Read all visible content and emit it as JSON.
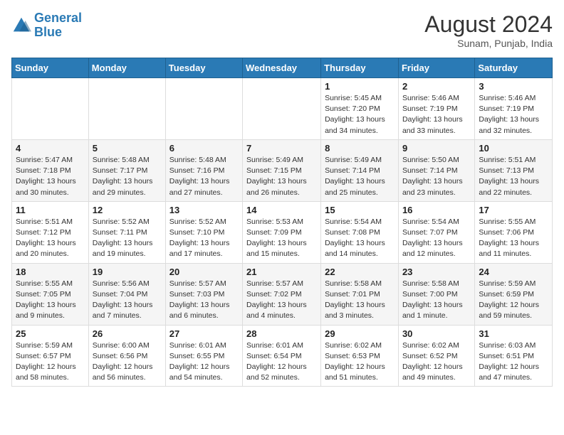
{
  "header": {
    "logo_general": "General",
    "logo_blue": "Blue",
    "month_year": "August 2024",
    "location": "Sunam, Punjab, India"
  },
  "days_of_week": [
    "Sunday",
    "Monday",
    "Tuesday",
    "Wednesday",
    "Thursday",
    "Friday",
    "Saturday"
  ],
  "weeks": [
    [
      {
        "day": "",
        "info": ""
      },
      {
        "day": "",
        "info": ""
      },
      {
        "day": "",
        "info": ""
      },
      {
        "day": "",
        "info": ""
      },
      {
        "day": "1",
        "info": "Sunrise: 5:45 AM\nSunset: 7:20 PM\nDaylight: 13 hours\nand 34 minutes."
      },
      {
        "day": "2",
        "info": "Sunrise: 5:46 AM\nSunset: 7:19 PM\nDaylight: 13 hours\nand 33 minutes."
      },
      {
        "day": "3",
        "info": "Sunrise: 5:46 AM\nSunset: 7:19 PM\nDaylight: 13 hours\nand 32 minutes."
      }
    ],
    [
      {
        "day": "4",
        "info": "Sunrise: 5:47 AM\nSunset: 7:18 PM\nDaylight: 13 hours\nand 30 minutes."
      },
      {
        "day": "5",
        "info": "Sunrise: 5:48 AM\nSunset: 7:17 PM\nDaylight: 13 hours\nand 29 minutes."
      },
      {
        "day": "6",
        "info": "Sunrise: 5:48 AM\nSunset: 7:16 PM\nDaylight: 13 hours\nand 27 minutes."
      },
      {
        "day": "7",
        "info": "Sunrise: 5:49 AM\nSunset: 7:15 PM\nDaylight: 13 hours\nand 26 minutes."
      },
      {
        "day": "8",
        "info": "Sunrise: 5:49 AM\nSunset: 7:14 PM\nDaylight: 13 hours\nand 25 minutes."
      },
      {
        "day": "9",
        "info": "Sunrise: 5:50 AM\nSunset: 7:14 PM\nDaylight: 13 hours\nand 23 minutes."
      },
      {
        "day": "10",
        "info": "Sunrise: 5:51 AM\nSunset: 7:13 PM\nDaylight: 13 hours\nand 22 minutes."
      }
    ],
    [
      {
        "day": "11",
        "info": "Sunrise: 5:51 AM\nSunset: 7:12 PM\nDaylight: 13 hours\nand 20 minutes."
      },
      {
        "day": "12",
        "info": "Sunrise: 5:52 AM\nSunset: 7:11 PM\nDaylight: 13 hours\nand 19 minutes."
      },
      {
        "day": "13",
        "info": "Sunrise: 5:52 AM\nSunset: 7:10 PM\nDaylight: 13 hours\nand 17 minutes."
      },
      {
        "day": "14",
        "info": "Sunrise: 5:53 AM\nSunset: 7:09 PM\nDaylight: 13 hours\nand 15 minutes."
      },
      {
        "day": "15",
        "info": "Sunrise: 5:54 AM\nSunset: 7:08 PM\nDaylight: 13 hours\nand 14 minutes."
      },
      {
        "day": "16",
        "info": "Sunrise: 5:54 AM\nSunset: 7:07 PM\nDaylight: 13 hours\nand 12 minutes."
      },
      {
        "day": "17",
        "info": "Sunrise: 5:55 AM\nSunset: 7:06 PM\nDaylight: 13 hours\nand 11 minutes."
      }
    ],
    [
      {
        "day": "18",
        "info": "Sunrise: 5:55 AM\nSunset: 7:05 PM\nDaylight: 13 hours\nand 9 minutes."
      },
      {
        "day": "19",
        "info": "Sunrise: 5:56 AM\nSunset: 7:04 PM\nDaylight: 13 hours\nand 7 minutes."
      },
      {
        "day": "20",
        "info": "Sunrise: 5:57 AM\nSunset: 7:03 PM\nDaylight: 13 hours\nand 6 minutes."
      },
      {
        "day": "21",
        "info": "Sunrise: 5:57 AM\nSunset: 7:02 PM\nDaylight: 13 hours\nand 4 minutes."
      },
      {
        "day": "22",
        "info": "Sunrise: 5:58 AM\nSunset: 7:01 PM\nDaylight: 13 hours\nand 3 minutes."
      },
      {
        "day": "23",
        "info": "Sunrise: 5:58 AM\nSunset: 7:00 PM\nDaylight: 13 hours\nand 1 minute."
      },
      {
        "day": "24",
        "info": "Sunrise: 5:59 AM\nSunset: 6:59 PM\nDaylight: 12 hours\nand 59 minutes."
      }
    ],
    [
      {
        "day": "25",
        "info": "Sunrise: 5:59 AM\nSunset: 6:57 PM\nDaylight: 12 hours\nand 58 minutes."
      },
      {
        "day": "26",
        "info": "Sunrise: 6:00 AM\nSunset: 6:56 PM\nDaylight: 12 hours\nand 56 minutes."
      },
      {
        "day": "27",
        "info": "Sunrise: 6:01 AM\nSunset: 6:55 PM\nDaylight: 12 hours\nand 54 minutes."
      },
      {
        "day": "28",
        "info": "Sunrise: 6:01 AM\nSunset: 6:54 PM\nDaylight: 12 hours\nand 52 minutes."
      },
      {
        "day": "29",
        "info": "Sunrise: 6:02 AM\nSunset: 6:53 PM\nDaylight: 12 hours\nand 51 minutes."
      },
      {
        "day": "30",
        "info": "Sunrise: 6:02 AM\nSunset: 6:52 PM\nDaylight: 12 hours\nand 49 minutes."
      },
      {
        "day": "31",
        "info": "Sunrise: 6:03 AM\nSunset: 6:51 PM\nDaylight: 12 hours\nand 47 minutes."
      }
    ]
  ]
}
